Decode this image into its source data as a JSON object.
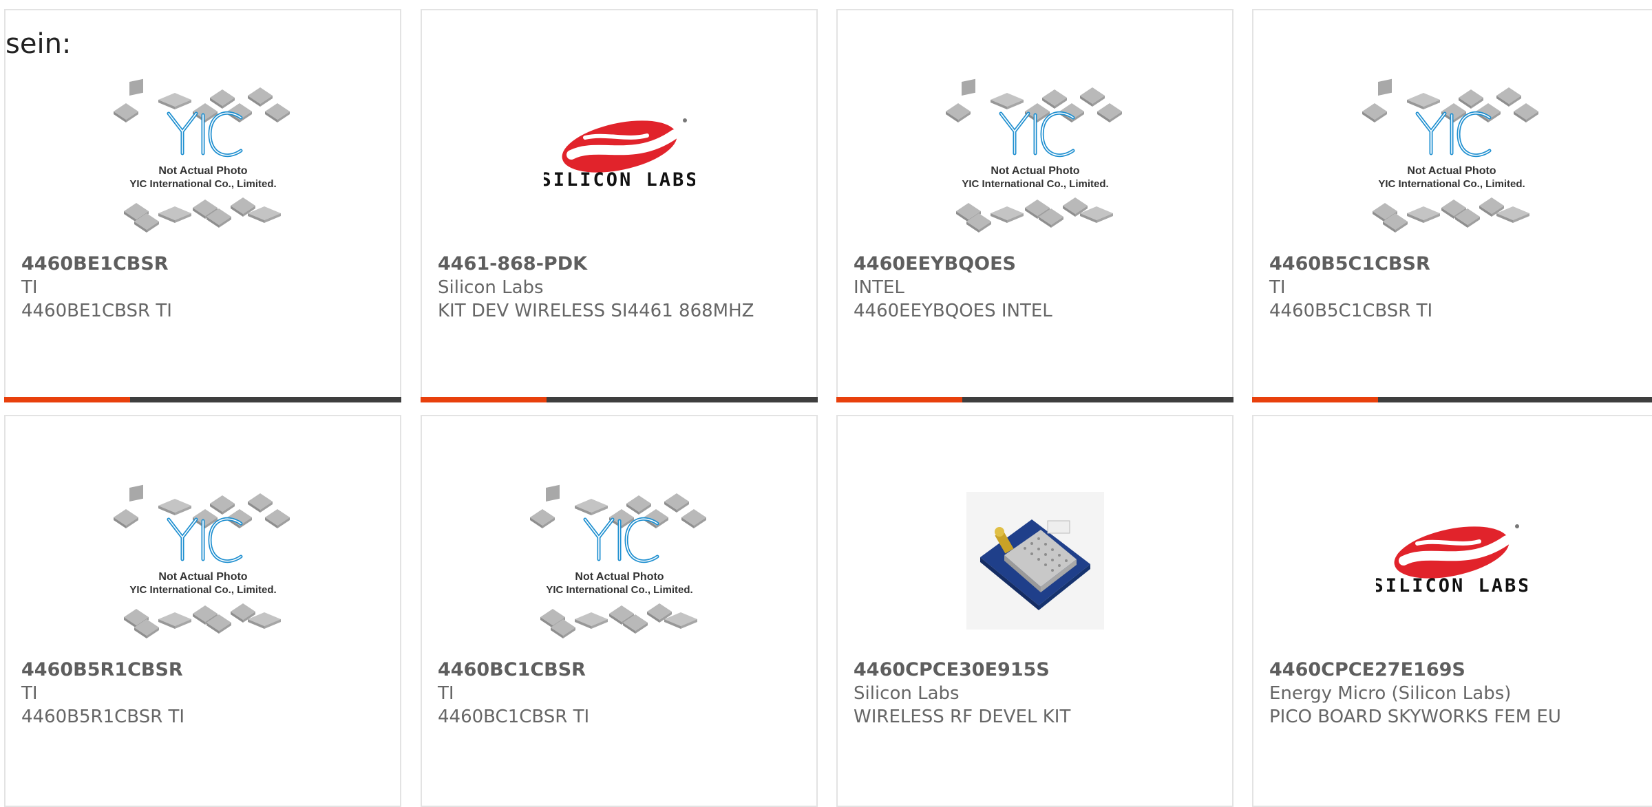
{
  "lead_text": "sein:",
  "colors": {
    "accent": "#e8400c",
    "dark": "#3e3e3e"
  },
  "placeholder": {
    "line1": "Not Actual Photo",
    "line2": "YIC International Co., Limited.",
    "logo_text": "YIC"
  },
  "products": [
    {
      "part": "4460BE1CBSR",
      "maker": "TI",
      "desc": "4460BE1CBSR TI",
      "image": "yic-placeholder"
    },
    {
      "part": "4461-868-PDK",
      "maker": "Silicon Labs",
      "desc": "KIT DEV WIRELESS SI4461 868MHZ",
      "image": "silicon-labs-logo",
      "logo_text": "SILICON LABS"
    },
    {
      "part": "4460EEYBQOES",
      "maker": "INTEL",
      "desc": "4460EEYBQOES INTEL",
      "image": "yic-placeholder"
    },
    {
      "part": "4460B5C1CBSR",
      "maker": "TI",
      "desc": "4460B5C1CBSR TI",
      "image": "yic-placeholder"
    },
    {
      "part": "4460B5R1CBSR",
      "maker": "TI",
      "desc": "4460B5R1CBSR TI",
      "image": "yic-placeholder"
    },
    {
      "part": "4460BC1CBSR",
      "maker": "TI",
      "desc": "4460BC1CBSR TI",
      "image": "yic-placeholder"
    },
    {
      "part": "4460CPCE30E915S",
      "maker": "Silicon Labs",
      "desc": "WIRELESS RF DEVEL KIT",
      "image": "rf-module-photo"
    },
    {
      "part": "4460CPCE27E169S",
      "maker": "Energy Micro (Silicon Labs)",
      "desc": "PICO BOARD SKYWORKS FEM EU",
      "image": "silicon-labs-logo",
      "logo_text": "SILICON LABS"
    }
  ]
}
